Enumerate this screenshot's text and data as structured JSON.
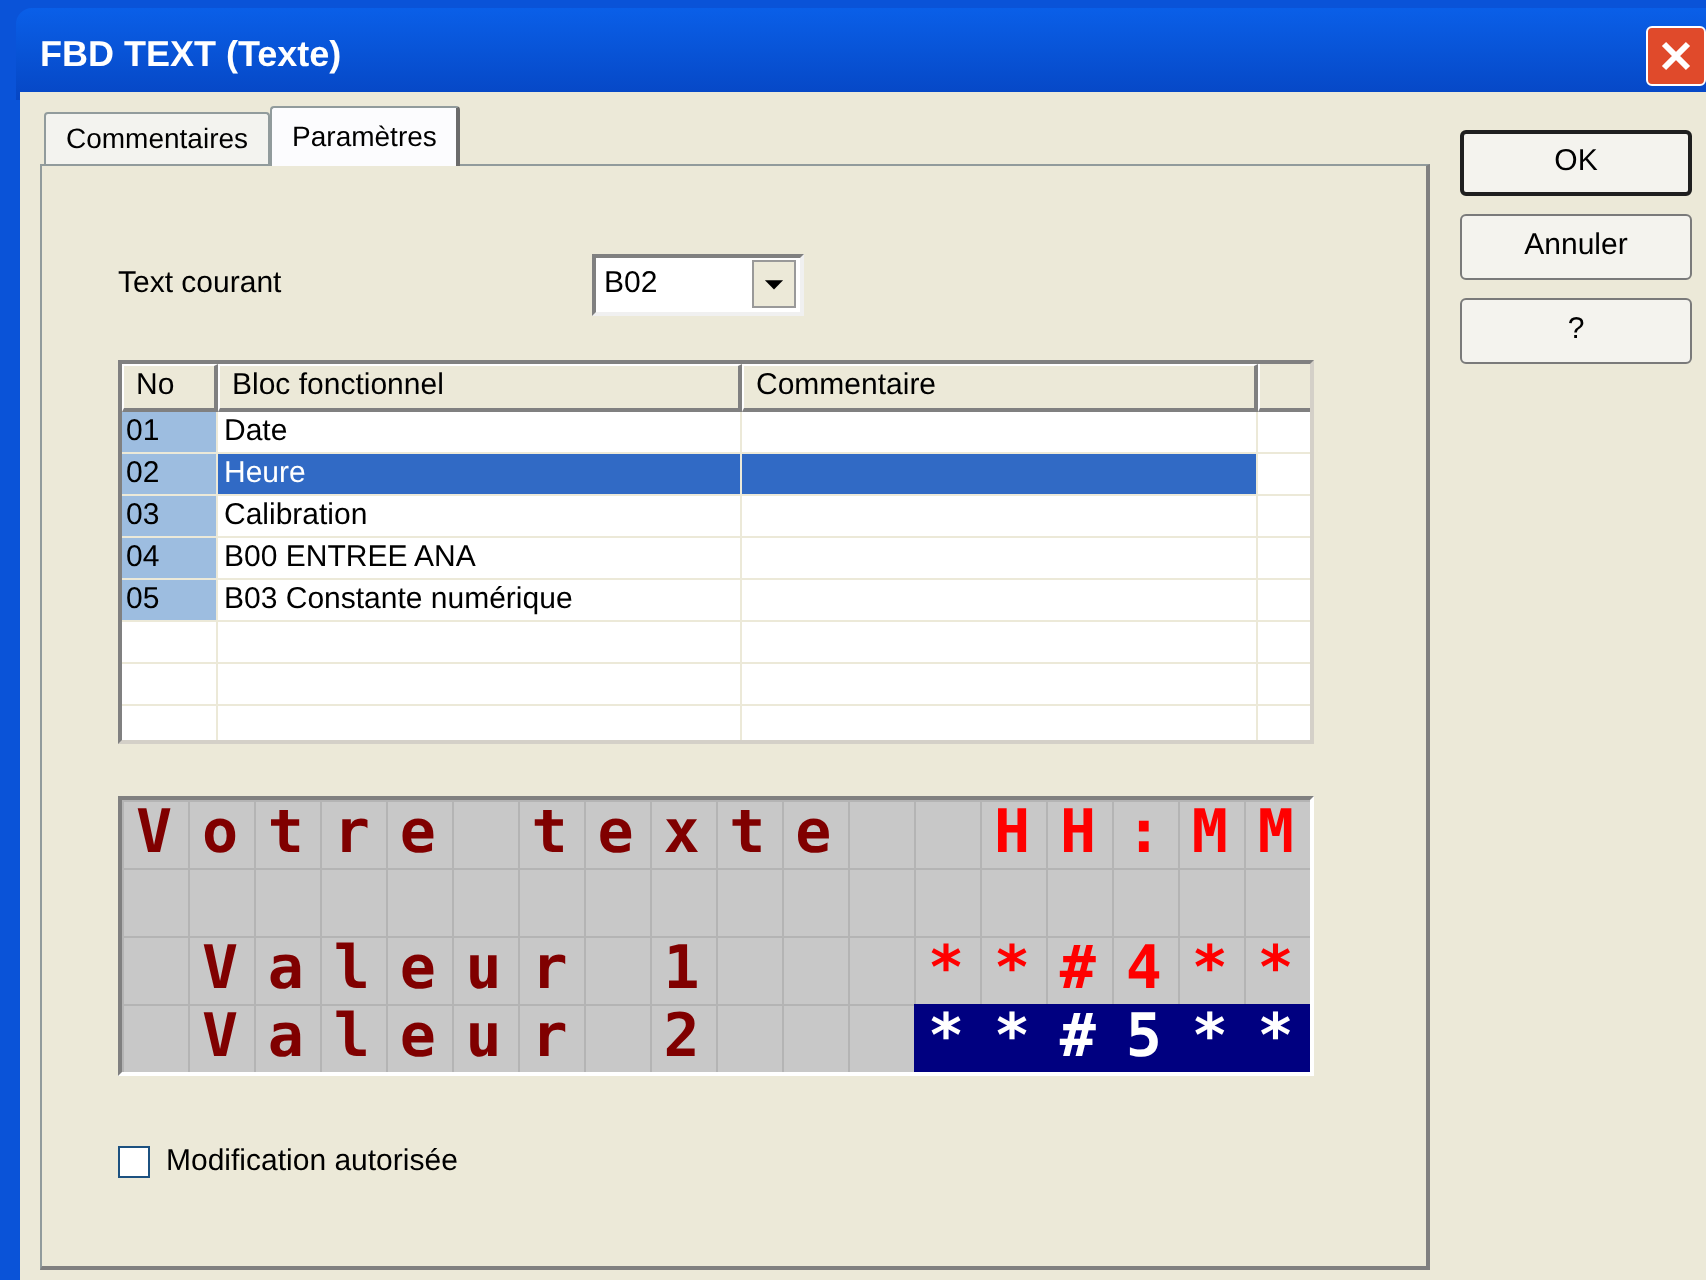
{
  "window": {
    "title": "FBD TEXT (Texte)"
  },
  "tabs": [
    {
      "label": "Commentaires",
      "selected": false
    },
    {
      "label": "Paramètres",
      "selected": true
    }
  ],
  "current_text": {
    "label": "Text courant",
    "value": "B02"
  },
  "table": {
    "columns": [
      "No",
      "Bloc fonctionnel",
      "Commentaire"
    ],
    "rows": [
      {
        "no": "01",
        "block": "Date",
        "selected": false
      },
      {
        "no": "02",
        "block": "Heure",
        "selected": true
      },
      {
        "no": "03",
        "block": "Calibration",
        "selected": false
      },
      {
        "no": "04",
        "block": "B00 ENTREE ANA",
        "selected": false
      },
      {
        "no": "05",
        "block": "B03 Constante numérique",
        "selected": false
      }
    ]
  },
  "lcd": {
    "rows": [
      {
        "segments": [
          {
            "text": "Votre texte  ",
            "kind": "text"
          },
          {
            "text": "HH:MM",
            "kind": "field"
          }
        ]
      },
      {},
      {
        "segments": [
          {
            "text": " Valeur 1   ",
            "kind": "text"
          },
          {
            "text": "**#4**",
            "kind": "field"
          }
        ]
      },
      {
        "segments": [
          {
            "text": " Valeur 2   ",
            "kind": "text"
          },
          {
            "text": "**#5**",
            "kind": "highlight"
          }
        ]
      }
    ]
  },
  "modification": {
    "label": "Modification autorisée",
    "checked": false
  },
  "buttons": [
    "OK",
    "Annuler",
    "?"
  ]
}
